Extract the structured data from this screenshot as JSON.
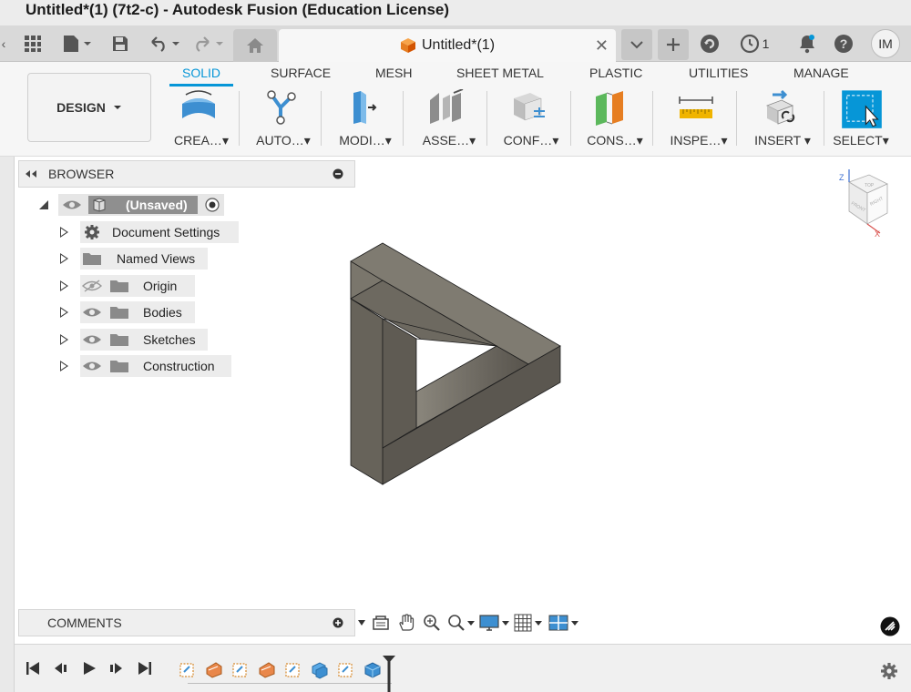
{
  "window": {
    "title": "Untitled*(1) (7t2-c) - Autodesk Fusion (Education License)"
  },
  "app_toolbar": {
    "document_tab": "Untitled*(1)",
    "job_count": "1",
    "user_initials": "IM"
  },
  "ribbon": {
    "workspace": "DESIGN",
    "tabs": [
      "SOLID",
      "SURFACE",
      "MESH",
      "SHEET METAL",
      "PLASTIC",
      "UTILITIES",
      "MANAGE"
    ],
    "active_tab": "SOLID",
    "groups": [
      "CREA…",
      "AUTO…",
      "MODI…",
      "ASSE…",
      "CONF…",
      "CONS…",
      "INSPE…",
      "INSERT",
      "SELECT"
    ]
  },
  "browser": {
    "title": "BROWSER",
    "root": "(Unsaved)",
    "items": [
      "Document Settings",
      "Named Views",
      "Origin",
      "Bodies",
      "Sketches",
      "Construction"
    ]
  },
  "comments": {
    "title": "COMMENTS"
  },
  "viewcube": {
    "axis_z": "Z",
    "axis_x": "X",
    "face_top": "TOP",
    "face_front": "FRONT",
    "face_right": "RIGHT"
  },
  "colors": {
    "accent": "#0696d7",
    "model_top": "#7b776d",
    "model_side": "#5f5b53"
  }
}
